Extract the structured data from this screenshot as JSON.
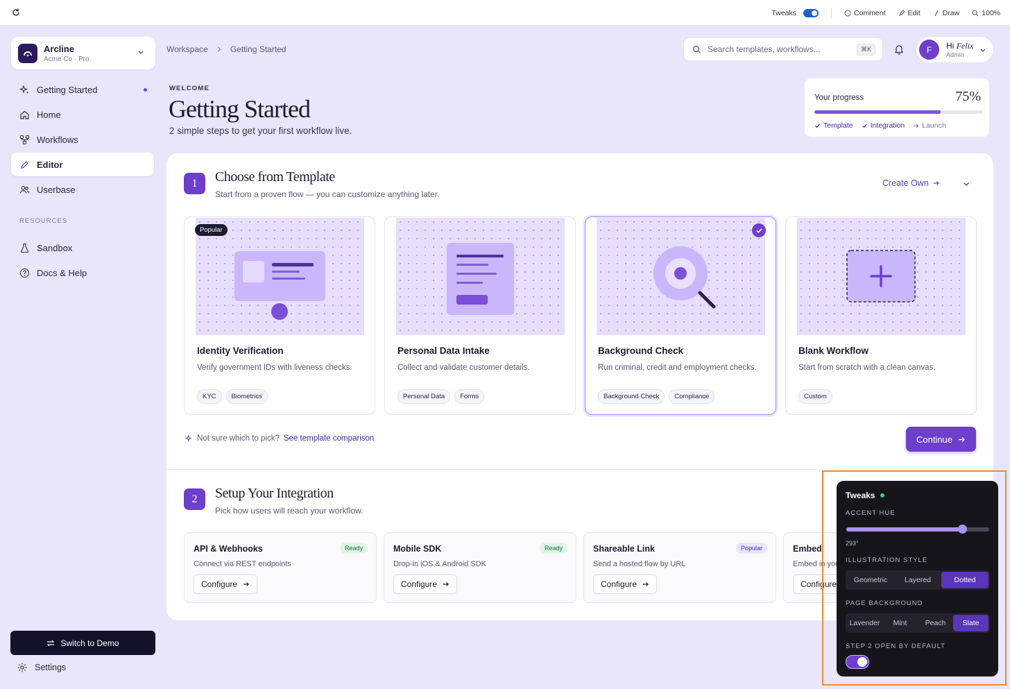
{
  "topbar": {
    "tweaks_label": "Tweaks",
    "comment_label": "Comment",
    "edit_label": "Edit",
    "draw_label": "Draw",
    "zoom_label": "100%"
  },
  "brand": {
    "name": "Arcline",
    "sub": "Acme Co · Pro"
  },
  "sidebar": {
    "items": [
      {
        "label": "Getting Started",
        "icon": "sparkle-icon"
      },
      {
        "label": "Home",
        "icon": "home-icon"
      },
      {
        "label": "Workflows",
        "icon": "workflow-icon"
      },
      {
        "label": "Editor",
        "icon": "pencil-icon"
      },
      {
        "label": "Userbase",
        "icon": "users-icon"
      }
    ],
    "section_label": "RESOURCES",
    "resources": [
      {
        "label": "Sandbox",
        "icon": "flask-icon"
      },
      {
        "label": "Docs & Help",
        "icon": "help-icon"
      }
    ],
    "switch_demo": "Switch to Demo",
    "settings": "Settings"
  },
  "breadcrumb": {
    "root": "Workspace",
    "current": "Getting Started"
  },
  "search": {
    "placeholder": "Search templates, workflows...",
    "shortcut": "⌘K"
  },
  "user": {
    "initial": "F",
    "greeting": "Hi",
    "name": "Felix",
    "role": "Admin"
  },
  "header": {
    "eyebrow": "WELCOME",
    "title": "Getting Started",
    "subtitle": "2 simple steps to get your first workflow live."
  },
  "progress": {
    "label": "Your progress",
    "percent_text": "75%",
    "fraction": 0.75,
    "steps": [
      {
        "label": "Template",
        "state": "done"
      },
      {
        "label": "Integration",
        "state": "done"
      },
      {
        "label": "Launch",
        "state": "pending"
      }
    ]
  },
  "step1": {
    "number": "1",
    "title": "Choose from Template",
    "subtitle": "Start from a proven flow — you can customize anything later.",
    "create_own": "Create Own",
    "templates": [
      {
        "name": "Identity Verification",
        "desc": "Verify government IDs with liveness checks.",
        "tags": [
          "KYC",
          "Biometrics"
        ],
        "badge": "Popular"
      },
      {
        "name": "Personal Data Intake",
        "desc": "Collect and validate customer details.",
        "tags": [
          "Personal Data",
          "Forms"
        ]
      },
      {
        "name": "Background Check",
        "desc": "Run criminal, credit and employment checks.",
        "tags": [
          "Background Check",
          "Compliance"
        ]
      },
      {
        "name": "Blank Workflow",
        "desc": "Start from scratch with a clean canvas.",
        "tags": [
          "Custom"
        ]
      }
    ],
    "hint_text": "Not sure which to pick?",
    "hint_link": "See template comparison",
    "continue": "Continue"
  },
  "step2": {
    "number": "2",
    "title": "Setup Your Integration",
    "subtitle": "Pick how users will reach your workflow.",
    "integrations": [
      {
        "name": "API & Webhooks",
        "desc": "Connect via REST endpoints",
        "badge": "Ready",
        "action": "Configure"
      },
      {
        "name": "Mobile SDK",
        "desc": "Drop-in iOS & Android SDK",
        "badge": "Ready",
        "action": "Configure"
      },
      {
        "name": "Shareable Link",
        "desc": "Send a hosted flow by URL",
        "badge": "Popular",
        "action": "Configure"
      },
      {
        "name": "Embed",
        "desc": "Embed in your app",
        "action": "Configure"
      }
    ]
  },
  "tweaks": {
    "title": "Tweaks",
    "accent_label": "ACCENT HUE",
    "accent_value": "293°",
    "accent_fraction": 0.81,
    "style_label": "ILLUSTRATION STYLE",
    "style_options": [
      "Geometric",
      "Layered",
      "Dotted"
    ],
    "style_selected": "Dotted",
    "bg_label": "PAGE BACKGROUND",
    "bg_options": [
      "Lavender",
      "Mint",
      "Peach",
      "Slate"
    ],
    "bg_selected": "Slate",
    "step2_label": "STEP 2 OPEN BY DEFAULT"
  }
}
